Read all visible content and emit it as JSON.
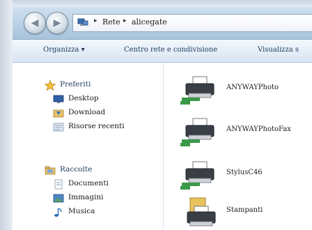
{
  "address": {
    "crumbs": [
      "Rete",
      "alicegate"
    ],
    "separator": "▸"
  },
  "toolbar": {
    "items": [
      "Organizza ▾",
      "Centro rete e condivisione",
      "Visualizza s"
    ]
  },
  "nav": {
    "favorites": {
      "label": "Preferiti",
      "items": [
        "Desktop",
        "Download",
        "Risorse recenti"
      ]
    },
    "libraries": {
      "label": "Raccolte",
      "items": [
        "Documenti",
        "Immagini",
        "Musica"
      ]
    }
  },
  "content": {
    "items": [
      "ANYWAYPhoto",
      "ANYWAYPhotoFax",
      "StylusC46",
      "Stampanti"
    ]
  },
  "colors": {
    "toolbar_text": "#1e395b",
    "printer_green": "#3a9a4a",
    "folder_yellow": "#e8c25a"
  }
}
